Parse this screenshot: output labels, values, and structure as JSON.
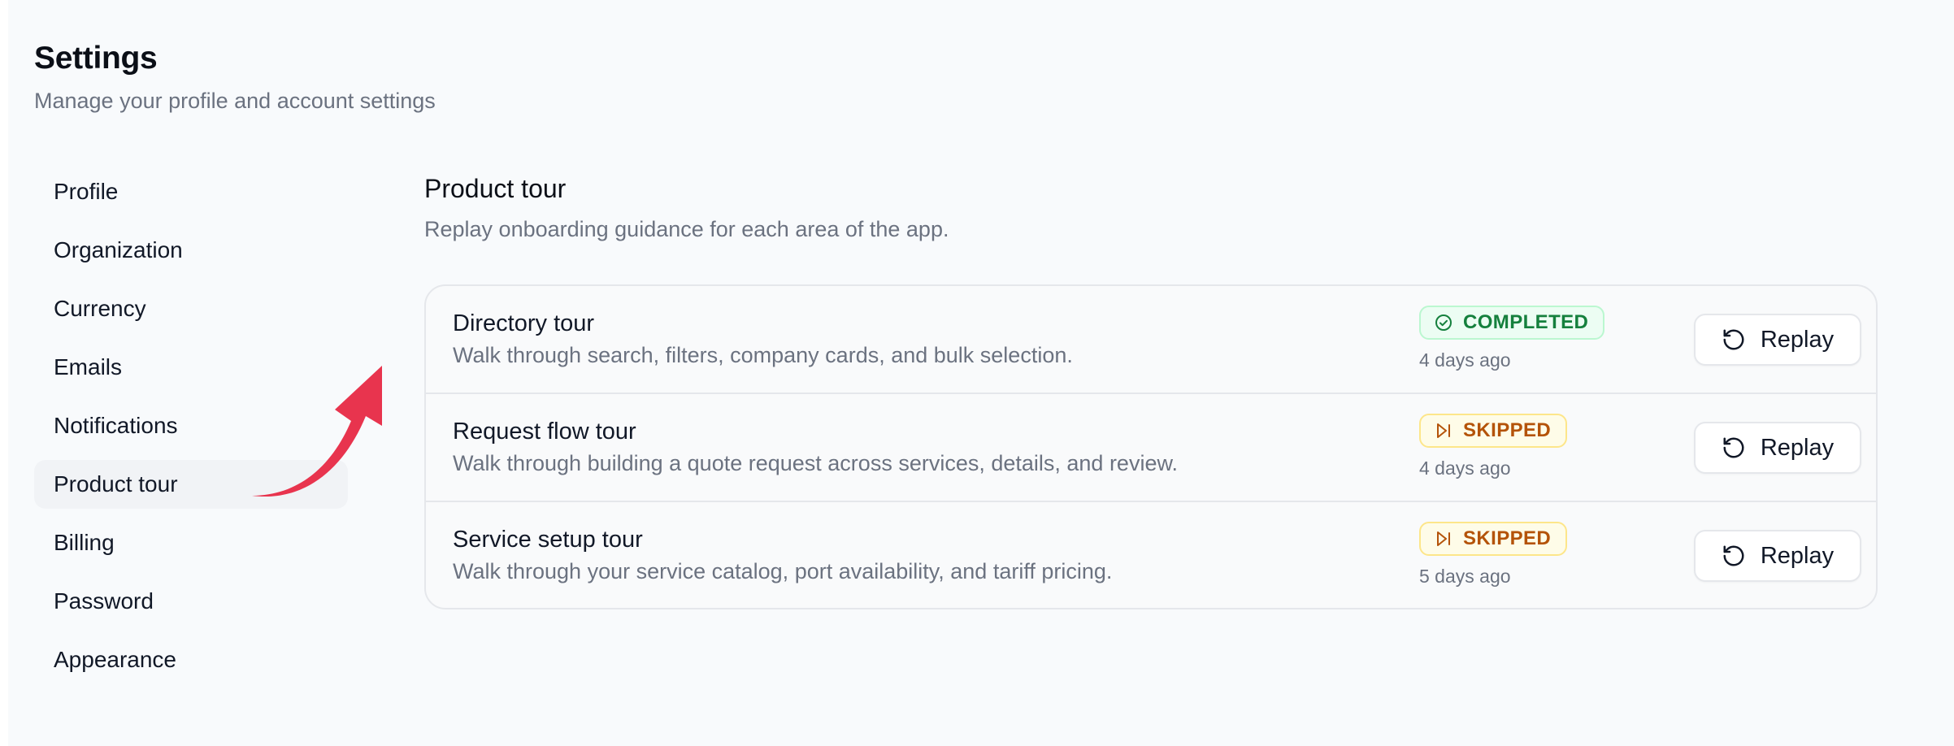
{
  "header": {
    "title": "Settings",
    "subtitle": "Manage your profile and account settings"
  },
  "sidebar": {
    "active": "Product tour",
    "items": [
      {
        "label": "Profile"
      },
      {
        "label": "Organization"
      },
      {
        "label": "Currency"
      },
      {
        "label": "Emails"
      },
      {
        "label": "Notifications"
      },
      {
        "label": "Product tour"
      },
      {
        "label": "Billing"
      },
      {
        "label": "Password"
      },
      {
        "label": "Appearance"
      }
    ]
  },
  "section": {
    "title": "Product tour",
    "subtitle": "Replay onboarding guidance for each area of the app."
  },
  "tours": [
    {
      "title": "Directory tour",
      "description": "Walk through search, filters, company cards, and bulk selection.",
      "status": "COMPLETED",
      "status_icon": "check-circle-icon",
      "time": "4 days ago",
      "button_label": "Replay"
    },
    {
      "title": "Request flow tour",
      "description": "Walk through building a quote request across services, details, and review.",
      "status": "SKIPPED",
      "status_icon": "skip-forward-icon",
      "time": "4 days ago",
      "button_label": "Replay"
    },
    {
      "title": "Service setup tour",
      "description": "Walk through your service catalog, port availability, and tariff pricing.",
      "status": "SKIPPED",
      "status_icon": "skip-forward-icon",
      "time": "5 days ago",
      "button_label": "Replay"
    }
  ],
  "colors": {
    "completed": "#15803d",
    "skipped": "#b45309",
    "arrow": "#e8344e"
  }
}
